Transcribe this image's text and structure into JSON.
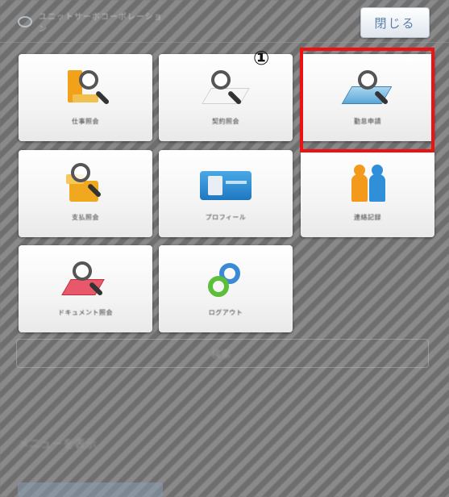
{
  "header": {
    "logo_text": "ユニットサーボコーポレーション",
    "close_label": "閉じる"
  },
  "annotation": {
    "marker": "①"
  },
  "tiles": [
    {
      "label": "仕事照会",
      "icon": "work-inquiry-icon"
    },
    {
      "label": "契約照会",
      "icon": "contract-inquiry-icon"
    },
    {
      "label": "勤怠申請",
      "icon": "attendance-request-icon"
    },
    {
      "label": "支払照会",
      "icon": "payment-inquiry-icon"
    },
    {
      "label": "プロフィール",
      "icon": "profile-card-icon"
    },
    {
      "label": "連絡記録",
      "icon": "contact-record-icon"
    },
    {
      "label": "ドキュメント照会",
      "icon": "document-inquiry-icon"
    },
    {
      "label": "ログアウト",
      "icon": "logout-icon"
    }
  ],
  "background": {
    "search_text": "検索",
    "footer_text": "メニューを表示"
  },
  "colors": {
    "highlight": "#ee1111",
    "accent": "#5a7fa8"
  }
}
